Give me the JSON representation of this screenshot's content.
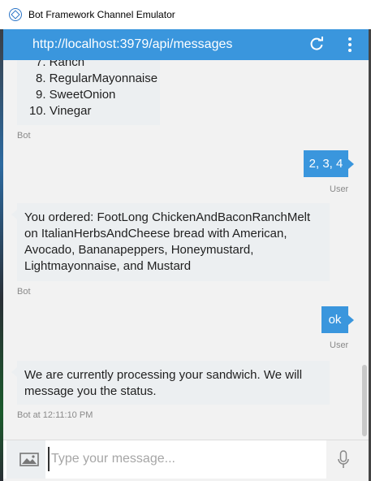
{
  "window": {
    "title": "Bot Framework Channel Emulator"
  },
  "header": {
    "url": "http://localhost:3979/api/messages",
    "refresh_icon": "refresh-icon",
    "menu_icon": "more-vertical-icon"
  },
  "messages": {
    "list_items": [
      "7. Ranch",
      "8. RegularMayonnaise",
      "9. SweetOnion",
      "10. Vinegar"
    ],
    "list_meta": "Bot",
    "user1_text": "2, 3, 4",
    "user1_meta": "User",
    "order_text": "You ordered: FootLong ChickenAndBaconRanchMelt on ItalianHerbsAndCheese bread with American, Avocado, Bananapeppers, Honeymustard, Lightmayonnaise, and Mustard",
    "order_meta": "Bot",
    "user2_text": "ok",
    "user2_meta": "User",
    "processing_text": "We are currently processing your sandwich. We will message you the status.",
    "processing_meta": "Bot at 12:11:10 PM"
  },
  "composer": {
    "placeholder": "Type your message...",
    "value": "",
    "image_icon": "image-icon",
    "mic_icon": "microphone-icon"
  },
  "colors": {
    "header": "#3a96dd",
    "user_bubble": "#3a96dd",
    "bot_bubble": "#eceff1",
    "background": "#f2f2f2"
  }
}
